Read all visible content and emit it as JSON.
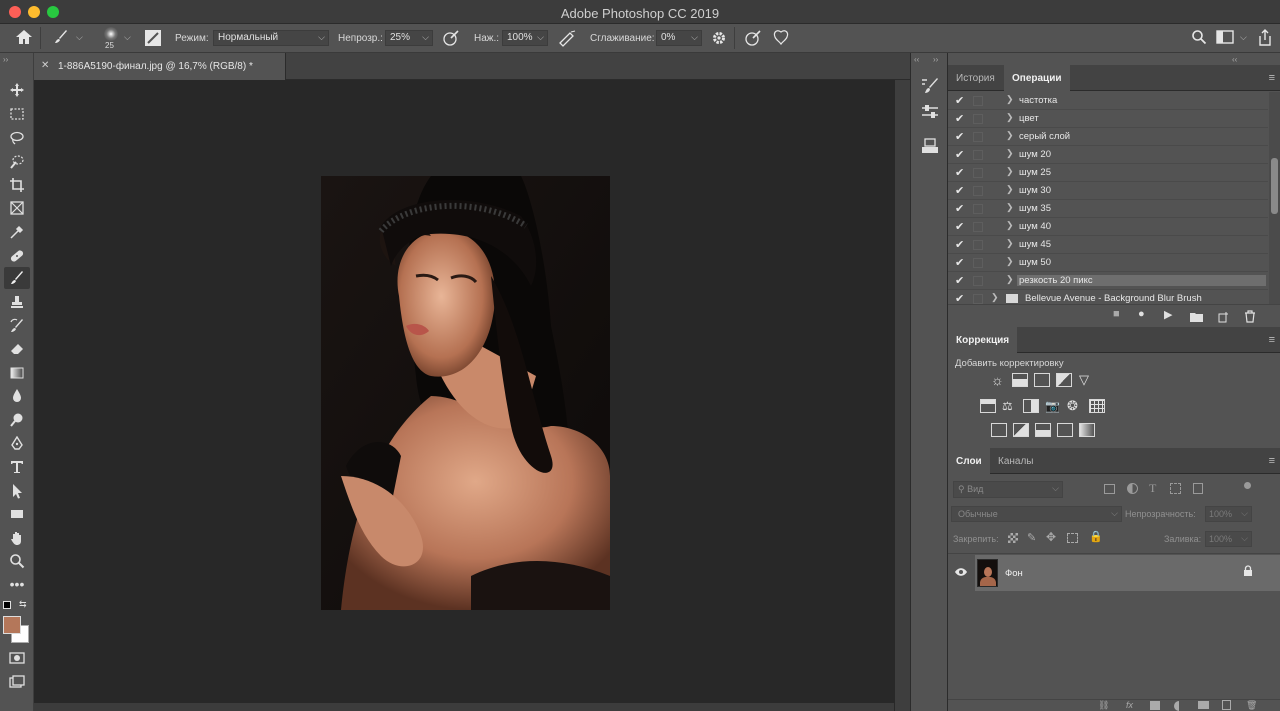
{
  "app": {
    "title": "Adobe Photoshop CC 2019"
  },
  "colors": {
    "foreground": "#b4775a",
    "background": "#ffffff"
  },
  "options": {
    "brush_size": "25",
    "mode_label": "Режим:",
    "mode_value": "Нормальный",
    "opacity_label": "Непрозр.:",
    "opacity_value": "25%",
    "flow_label": "Наж.:",
    "flow_value": "100%",
    "smoothing_label": "Сглаживание:",
    "smoothing_value": "0%"
  },
  "document": {
    "tab_title": "1-886A5190-финал.jpg @ 16,7% (RGB/8) *"
  },
  "panels": {
    "history_tab": "История",
    "actions_tab": "Операции",
    "actions": [
      "частотка",
      "цвет",
      "серый слой",
      "шум 20",
      "шум 25",
      "шум 30",
      "шум 35",
      "шум 40",
      "шум 45",
      "шум 50",
      "резкость 20 пикс"
    ],
    "actions_set": "Bellevue Avenue - Background Blur Brush",
    "adjustments_tab": "Коррекция",
    "adjustments_hint": "Добавить корректировку",
    "layers_tab": "Слои",
    "channels_tab": "Каналы",
    "layer_filter": "Вид",
    "blend_mode": "Обычные",
    "opacity_label": "Непрозрачность:",
    "opacity_value": "100%",
    "lock_label": "Закрепить:",
    "fill_label": "Заливка:",
    "fill_value": "100%",
    "layers": [
      {
        "name": "Фон"
      }
    ]
  }
}
